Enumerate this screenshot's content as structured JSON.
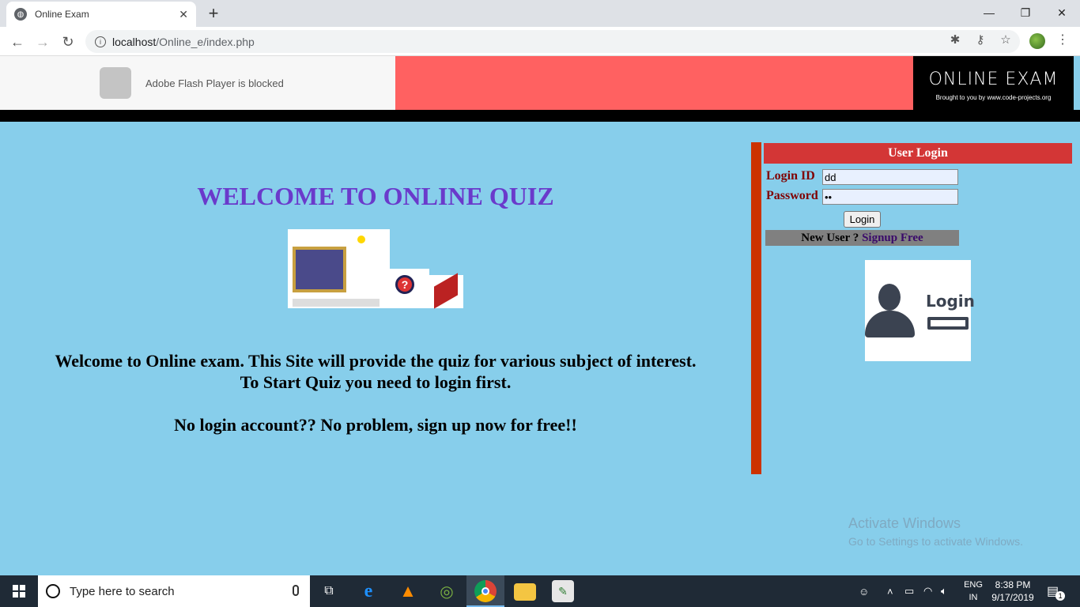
{
  "browser": {
    "tab_title": "Online Exam",
    "tab_close": "✕",
    "new_tab": "+",
    "url_host": "localhost",
    "url_path": "/Online_e/index.php",
    "controls": {
      "minimize": "—",
      "restore": "❐",
      "close": "✕"
    },
    "nav": {
      "back": "←",
      "forward": "→",
      "reload": "↻"
    },
    "icons": {
      "extensions": "puzzle-icon",
      "key": "key-icon",
      "star": "☆",
      "menu": "⋮"
    }
  },
  "header": {
    "flash_message": "Adobe Flash Player is blocked",
    "brand_title": "ONLINE EXAM",
    "brand_tagline": "Brought to you by www.code-projects.org",
    "colors": {
      "red_band": "#ff6161",
      "brand_bg": "#000000"
    }
  },
  "main": {
    "title": "WELCOME TO ONLINE QUIZ",
    "line1": "Welcome to Online exam. This Site will provide the quiz for various subject of interest.",
    "line2": "To Start Quiz you need to login first.",
    "line3": "No login account?? No problem, sign up now for free!!",
    "colors": {
      "title": "#6a3acb",
      "background": "#87ceeb"
    }
  },
  "login": {
    "heading": "User Login",
    "login_id_label": "Login ID",
    "login_id_value": "dd",
    "password_label": "Password",
    "password_value": "••",
    "button": "Login",
    "new_user_text": "New User ? ",
    "signup_text": "Signup Free",
    "illustration_text": "Login"
  },
  "watermark": {
    "line1": "Activate Windows",
    "line2": "Go to Settings to activate Windows."
  },
  "taskbar": {
    "search_placeholder": "Type here to search",
    "lang_top": "ENG",
    "lang_bottom": "IN",
    "time": "8:38 PM",
    "date": "9/17/2019",
    "notification_count": "1"
  }
}
